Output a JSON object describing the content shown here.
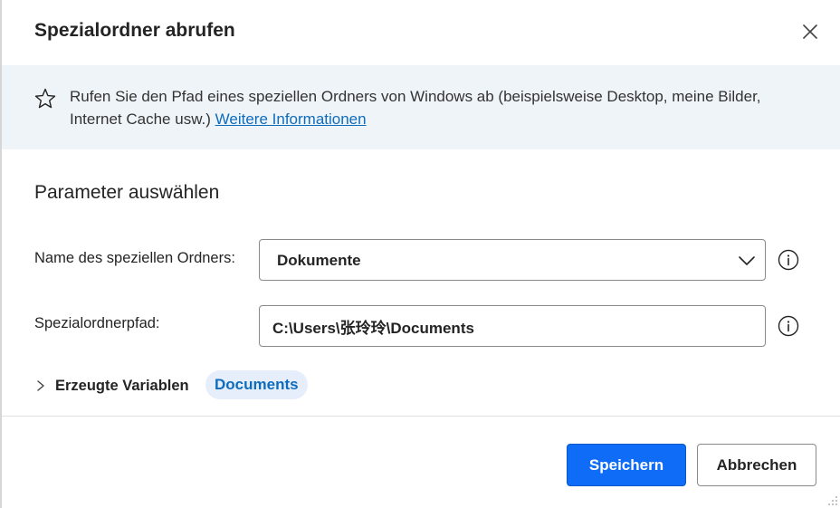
{
  "dialog": {
    "title": "Spezialordner abrufen",
    "close_icon": "close-icon"
  },
  "banner": {
    "icon": "star-icon",
    "description": "Rufen Sie den Pfad eines speziellen Ordners von Windows ab (beispielsweise Desktop, meine Bilder, Internet Cache usw.)",
    "link_label": "Weitere Informationen"
  },
  "parameters": {
    "section_title": "Parameter auswählen",
    "folder_name": {
      "label": "Name des speziellen Ordners:",
      "value": "Dokumente"
    },
    "folder_path": {
      "label": "Spezialordnerpfad:",
      "value": "C:\\Users\\张玲玲\\Documents"
    }
  },
  "variables": {
    "label": "Erzeugte Variablen",
    "items": [
      "Documents"
    ]
  },
  "footer": {
    "save_label": "Speichern",
    "cancel_label": "Abbrechen"
  },
  "colors": {
    "primary": "#0f6cf6",
    "link": "#0f6cbd",
    "banner_bg": "#eff4f9"
  }
}
